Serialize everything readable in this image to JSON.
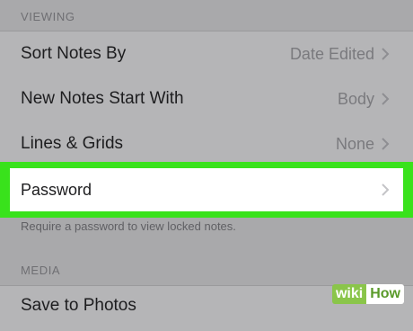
{
  "sections": {
    "viewing": "VIEWING",
    "media": "MEDIA"
  },
  "rows": {
    "sort_notes_by": {
      "label": "Sort Notes By",
      "value": "Date Edited"
    },
    "new_notes_start_with": {
      "label": "New Notes Start With",
      "value": "Body"
    },
    "lines_and_grids": {
      "label": "Lines & Grids",
      "value": "None"
    },
    "password": {
      "label": "Password"
    },
    "save_to_photos": {
      "label": "Save to Photos"
    }
  },
  "password_footer": "Require a password to view locked notes.",
  "watermark": {
    "wiki": "wiki",
    "how": "How"
  },
  "colors": {
    "highlight": "#39e21c",
    "background": "#a9a9ab"
  },
  "icons": {
    "chevron": "chevron-right-icon"
  }
}
